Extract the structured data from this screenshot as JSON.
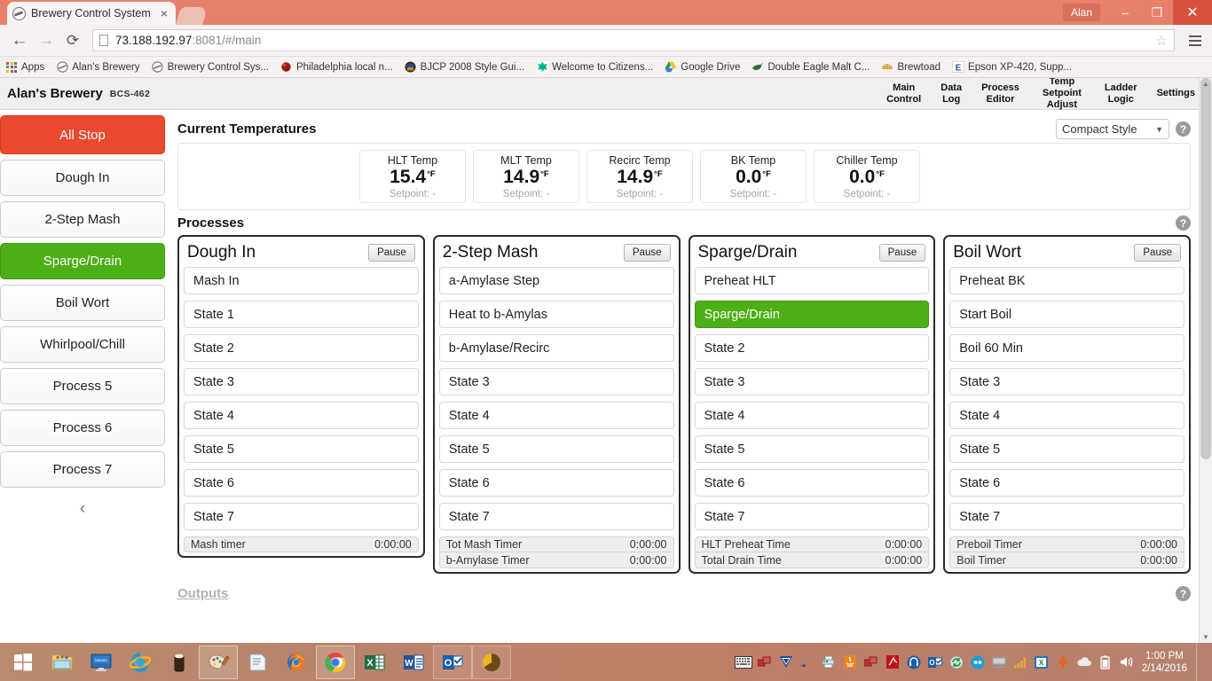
{
  "browser": {
    "tab_title": "Brewery Control System",
    "tab_close": "×",
    "url_host": "73.188.192.97",
    "url_rest": ":8081/#/main",
    "user_chip": "Alan",
    "minimize": "–",
    "maximize": "❐",
    "close": "✕",
    "back_icon": "←",
    "forward_icon": "→",
    "reload_icon": "⟳",
    "star_icon": "☆",
    "bookmarks": [
      {
        "label": "Apps",
        "icon": "apps-grid-icon"
      },
      {
        "label": "Alan's Brewery",
        "icon": "brewery-circle-icon"
      },
      {
        "label": "Brewery Control Sys...",
        "icon": "brewery-circle-icon"
      },
      {
        "label": "Philadelphia local n...",
        "icon": "red-ball-icon"
      },
      {
        "label": "BJCP 2008 Style Gui...",
        "icon": "bjcp-icon"
      },
      {
        "label": "Welcome to Citizens...",
        "icon": "citizens-icon"
      },
      {
        "label": "Google Drive",
        "icon": "google-drive-icon"
      },
      {
        "label": "Double Eagle Malt C...",
        "icon": "eagle-icon"
      },
      {
        "label": "Brewtoad",
        "icon": "brewtoad-icon"
      },
      {
        "label": "Epson XP-420, Supp...",
        "icon": "epson-e-icon"
      }
    ]
  },
  "app": {
    "brand": "Alan's Brewery",
    "model": "BCS-462",
    "nav": [
      {
        "line1": "Main",
        "line2": "Control"
      },
      {
        "line1": "Data",
        "line2": "Log"
      },
      {
        "line1": "Process",
        "line2": "Editor"
      },
      {
        "line1": "Temp Setpoint",
        "line2": "Adjust"
      },
      {
        "line1": "Ladder",
        "line2": "Logic"
      },
      {
        "line1": "Settings",
        "line2": ""
      }
    ]
  },
  "sidebar": {
    "all_stop": "All Stop",
    "items": [
      {
        "label": "Dough In",
        "active": false
      },
      {
        "label": "2-Step Mash",
        "active": false
      },
      {
        "label": "Sparge/Drain",
        "active": true
      },
      {
        "label": "Boil Wort",
        "active": false
      },
      {
        "label": "Whirlpool/Chill",
        "active": false
      },
      {
        "label": "Process 5",
        "active": false
      },
      {
        "label": "Process 6",
        "active": false
      },
      {
        "label": "Process 7",
        "active": false
      }
    ],
    "collapse_icon": "‹"
  },
  "temperatures": {
    "section_title": "Current Temperatures",
    "style_select_value": "Compact Style",
    "caret": "▼",
    "help": "?",
    "setpoint_prefix": "Setpoint:",
    "cards": [
      {
        "label": "HLT Temp",
        "value": "15.4",
        "unit": "°F",
        "setpoint": "Setpoint: -"
      },
      {
        "label": "MLT Temp",
        "value": "14.9",
        "unit": "°F",
        "setpoint": "Setpoint: -"
      },
      {
        "label": "Recirc Temp",
        "value": "14.9",
        "unit": "°F",
        "setpoint": "Setpoint: -"
      },
      {
        "label": "BK Temp",
        "value": "0.0",
        "unit": "°F",
        "setpoint": "Setpoint: -"
      },
      {
        "label": "Chiller Temp",
        "value": "0.0",
        "unit": "°F",
        "setpoint": "Setpoint: -"
      }
    ]
  },
  "processes": {
    "section_title": "Processes",
    "help": "?",
    "pause_label": "Pause",
    "cards": [
      {
        "name": "Dough In",
        "states": [
          {
            "label": "Mash In",
            "active": false
          },
          {
            "label": "State 1",
            "active": false
          },
          {
            "label": "State 2",
            "active": false
          },
          {
            "label": "State 3",
            "active": false
          },
          {
            "label": "State 4",
            "active": false
          },
          {
            "label": "State 5",
            "active": false
          },
          {
            "label": "State 6",
            "active": false
          },
          {
            "label": "State 7",
            "active": false
          }
        ],
        "timers": [
          {
            "label": "Mash timer",
            "value": "0:00:00"
          }
        ]
      },
      {
        "name": "2-Step Mash",
        "states": [
          {
            "label": "a-Amylase Step",
            "active": false
          },
          {
            "label": "Heat to b-Amylas",
            "active": false
          },
          {
            "label": "b-Amylase/Recirc",
            "active": false
          },
          {
            "label": "State 3",
            "active": false
          },
          {
            "label": "State 4",
            "active": false
          },
          {
            "label": "State 5",
            "active": false
          },
          {
            "label": "State 6",
            "active": false
          },
          {
            "label": "State 7",
            "active": false
          }
        ],
        "timers": [
          {
            "label": "Tot Mash Timer",
            "value": "0:00:00"
          },
          {
            "label": "b-Amylase Timer",
            "value": "0:00:00"
          }
        ]
      },
      {
        "name": "Sparge/Drain",
        "states": [
          {
            "label": "Preheat HLT",
            "active": false
          },
          {
            "label": "Sparge/Drain",
            "active": true
          },
          {
            "label": "State 2",
            "active": false
          },
          {
            "label": "State 3",
            "active": false
          },
          {
            "label": "State 4",
            "active": false
          },
          {
            "label": "State 5",
            "active": false
          },
          {
            "label": "State 6",
            "active": false
          },
          {
            "label": "State 7",
            "active": false
          }
        ],
        "timers": [
          {
            "label": "HLT Preheat Time",
            "value": "0:00:00"
          },
          {
            "label": "Total Drain Time",
            "value": "0:00:00"
          }
        ]
      },
      {
        "name": "Boil Wort",
        "states": [
          {
            "label": "Preheat BK",
            "active": false
          },
          {
            "label": "Start Boil",
            "active": false
          },
          {
            "label": "Boil 60 Min",
            "active": false
          },
          {
            "label": "State 3",
            "active": false
          },
          {
            "label": "State 4",
            "active": false
          },
          {
            "label": "State 5",
            "active": false
          },
          {
            "label": "State 6",
            "active": false
          },
          {
            "label": "State 7",
            "active": false
          }
        ],
        "timers": [
          {
            "label": "Preboil Timer",
            "value": "0:00:00"
          },
          {
            "label": "Boil Timer",
            "value": "0:00:00"
          }
        ]
      }
    ]
  },
  "outputs": {
    "title": "Outputs",
    "help": "?"
  },
  "taskbar": {
    "time": "1:00 PM",
    "date": "2/14/2016",
    "items": [
      {
        "name": "start-button"
      },
      {
        "name": "file-explorer"
      },
      {
        "name": "lenovo-app"
      },
      {
        "name": "internet-explorer"
      },
      {
        "name": "beer-glass-app"
      },
      {
        "name": "paint-app"
      },
      {
        "name": "notepad-app"
      },
      {
        "name": "firefox"
      },
      {
        "name": "google-chrome"
      },
      {
        "name": "excel"
      },
      {
        "name": "word"
      },
      {
        "name": "outlook"
      },
      {
        "name": "thunderbird"
      }
    ],
    "tray": [
      {
        "name": "show-hidden-icons"
      },
      {
        "name": "onscreen-keyboard"
      },
      {
        "name": "network-shared"
      },
      {
        "name": "vipre-security"
      },
      {
        "name": "printer"
      },
      {
        "name": "print-spooler"
      },
      {
        "name": "java"
      },
      {
        "name": "network-shared-2"
      },
      {
        "name": "adobe-reader"
      },
      {
        "name": "headset"
      },
      {
        "name": "outlook-tray"
      },
      {
        "name": "sync"
      },
      {
        "name": "intel-display"
      },
      {
        "name": "monitor"
      },
      {
        "name": "signal-bars"
      },
      {
        "name": "excel-tray"
      },
      {
        "name": "plug"
      },
      {
        "name": "onedrive"
      },
      {
        "name": "battery"
      },
      {
        "name": "volume"
      }
    ]
  }
}
